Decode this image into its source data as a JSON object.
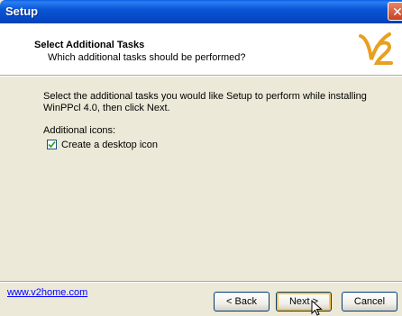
{
  "window": {
    "title": "Setup",
    "close_symbol": "✕"
  },
  "header": {
    "title": "Select Additional Tasks",
    "subtitle": "Which additional tasks should be performed?",
    "logo_icon": "v2-logo-icon"
  },
  "body": {
    "instructions": "Select the additional tasks you would like Setup to perform while installing WinPPcl 4.0, then click Next.",
    "section_label": "Additional icons:",
    "tasks": [
      {
        "label": "Create a desktop icon",
        "checked": true
      }
    ]
  },
  "footer": {
    "link": "www.v2home.com",
    "back_label": "< Back",
    "next_label": "Next >",
    "cancel_label": "Cancel"
  },
  "colors": {
    "titlebar": "#0a56d6",
    "accent_logo": "#e8a020",
    "link": "#0000ff"
  }
}
